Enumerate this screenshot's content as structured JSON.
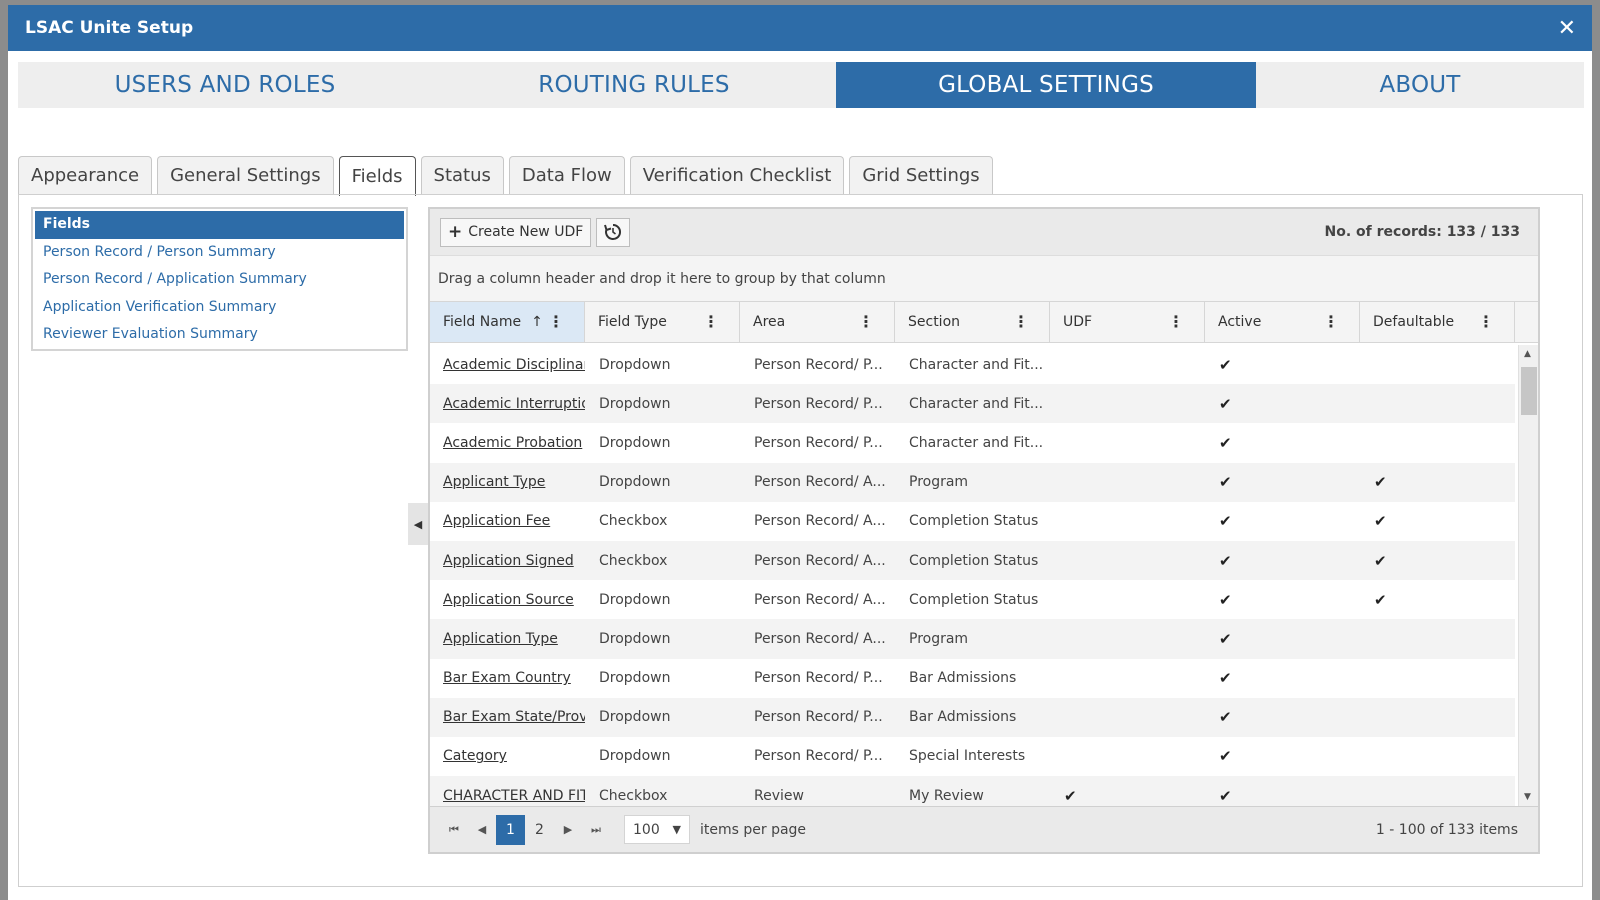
{
  "window": {
    "title": "LSAC Unite Setup",
    "close_glyph": "✕"
  },
  "main_tabs": [
    {
      "label": "USERS AND ROLES"
    },
    {
      "label": "ROUTING RULES"
    },
    {
      "label": "GLOBAL SETTINGS",
      "active": true
    },
    {
      "label": "ABOUT"
    }
  ],
  "sub_tabs": [
    {
      "label": "Appearance"
    },
    {
      "label": "General Settings"
    },
    {
      "label": "Fields",
      "active": true
    },
    {
      "label": "Status"
    },
    {
      "label": "Data Flow"
    },
    {
      "label": "Verification Checklist"
    },
    {
      "label": "Grid Settings"
    }
  ],
  "left_panel": {
    "items": [
      {
        "label": "Fields",
        "selected": true
      },
      {
        "label": "Person Record / Person Summary"
      },
      {
        "label": "Person Record / Application Summary"
      },
      {
        "label": "Application Verification Summary"
      },
      {
        "label": "Reviewer Evaluation Summary"
      }
    ]
  },
  "grid": {
    "toolbar": {
      "create_label": "Create New UDF",
      "records_text": "No. of records: 133 / 133"
    },
    "group_hint": "Drag a column header and drop it here to group by that column",
    "columns": [
      "Field Name",
      "Field Type",
      "Area",
      "Section",
      "UDF",
      "Active",
      "Defaultable"
    ],
    "sort_indicator": "↑",
    "rows": [
      {
        "name": "Academic Disciplinary",
        "type": "Dropdown",
        "area": "Person Record/ P...",
        "section": "Character and Fit...",
        "udf": "",
        "active": "✔",
        "defaultable": ""
      },
      {
        "name": "Academic Interruption",
        "type": "Dropdown",
        "area": "Person Record/ P...",
        "section": "Character and Fit...",
        "udf": "",
        "active": "✔",
        "defaultable": ""
      },
      {
        "name": "Academic Probation",
        "type": "Dropdown",
        "area": "Person Record/ P...",
        "section": "Character and Fit...",
        "udf": "",
        "active": "✔",
        "defaultable": ""
      },
      {
        "name": "Applicant Type",
        "type": "Dropdown",
        "area": "Person Record/ A...",
        "section": "Program",
        "udf": "",
        "active": "✔",
        "defaultable": "✔"
      },
      {
        "name": "Application Fee",
        "type": "Checkbox",
        "area": "Person Record/ A...",
        "section": "Completion Status",
        "udf": "",
        "active": "✔",
        "defaultable": "✔"
      },
      {
        "name": "Application Signed",
        "type": "Checkbox",
        "area": "Person Record/ A...",
        "section": "Completion Status",
        "udf": "",
        "active": "✔",
        "defaultable": "✔"
      },
      {
        "name": "Application Source",
        "type": "Dropdown",
        "area": "Person Record/ A...",
        "section": "Completion Status",
        "udf": "",
        "active": "✔",
        "defaultable": "✔"
      },
      {
        "name": "Application Type",
        "type": "Dropdown",
        "area": "Person Record/ A...",
        "section": "Program",
        "udf": "",
        "active": "✔",
        "defaultable": ""
      },
      {
        "name": "Bar Exam Country",
        "type": "Dropdown",
        "area": "Person Record/ P...",
        "section": "Bar Admissions",
        "udf": "",
        "active": "✔",
        "defaultable": ""
      },
      {
        "name": "Bar Exam State/Province",
        "type": "Dropdown",
        "area": "Person Record/ P...",
        "section": "Bar Admissions",
        "udf": "",
        "active": "✔",
        "defaultable": ""
      },
      {
        "name": "Category",
        "type": "Dropdown",
        "area": "Person Record/ P...",
        "section": "Special Interests",
        "udf": "",
        "active": "✔",
        "defaultable": ""
      },
      {
        "name": "CHARACTER AND FITNESS",
        "type": "Checkbox",
        "area": "Review",
        "section": "My Review",
        "udf": "✔",
        "active": "✔",
        "defaultable": ""
      }
    ],
    "pager": {
      "first": "⏮",
      "prev": "◀",
      "next": "▶",
      "last": "⏭",
      "pages": [
        "1",
        "2"
      ],
      "current_page": "1",
      "page_size": "100",
      "page_size_label": "items per page",
      "info": "1 - 100 of 133 items"
    }
  }
}
